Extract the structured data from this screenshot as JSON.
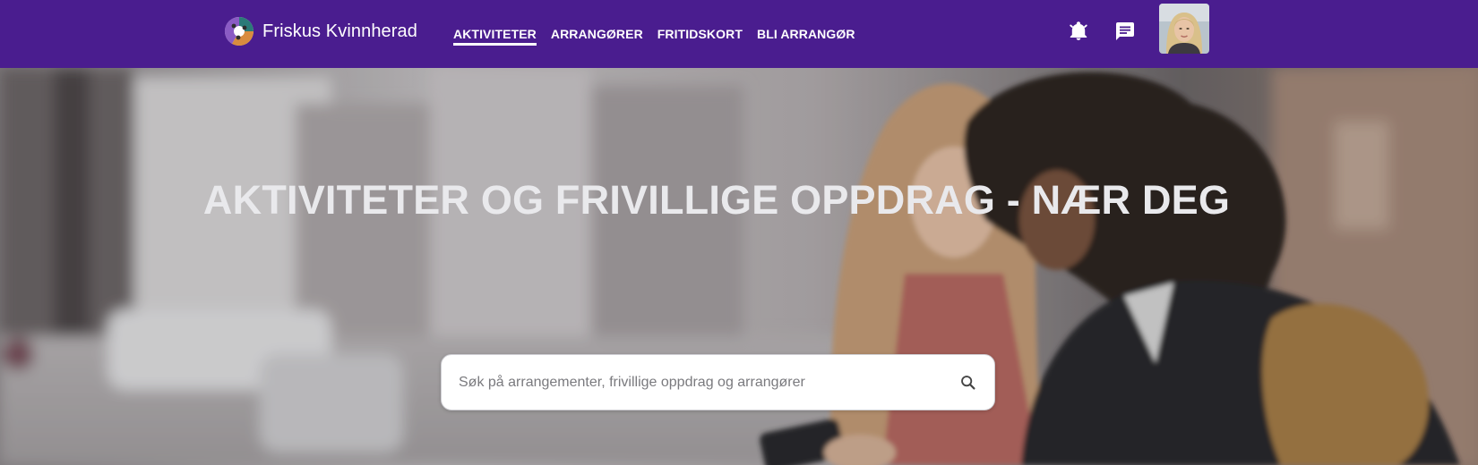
{
  "header": {
    "brand_name": "Friskus Kvinnherad",
    "nav": [
      {
        "label": "AKTIVITETER",
        "active": true
      },
      {
        "label": "ARRANGØRER",
        "active": false
      },
      {
        "label": "FRITIDSKORT",
        "active": false
      },
      {
        "label": "BLI ARRANGØR",
        "active": false
      }
    ],
    "icons": {
      "logo": "friskus-logo-icon",
      "notifications": "bell-icon",
      "messages": "chat-icon",
      "profile": "user-avatar"
    }
  },
  "hero": {
    "title": "AKTIVITETER OG FRIVILLIGE OPPDRAG - NÆR DEG",
    "search": {
      "placeholder": "Søk på arrangementer, frivillige oppdrag og arrangører",
      "value": "",
      "icon": "search-icon"
    }
  },
  "colors": {
    "header_bg": "#4a1d8f",
    "nav_text": "#ffffff",
    "hero_title": "#e9e9ec",
    "search_bg": "#ffffff"
  }
}
